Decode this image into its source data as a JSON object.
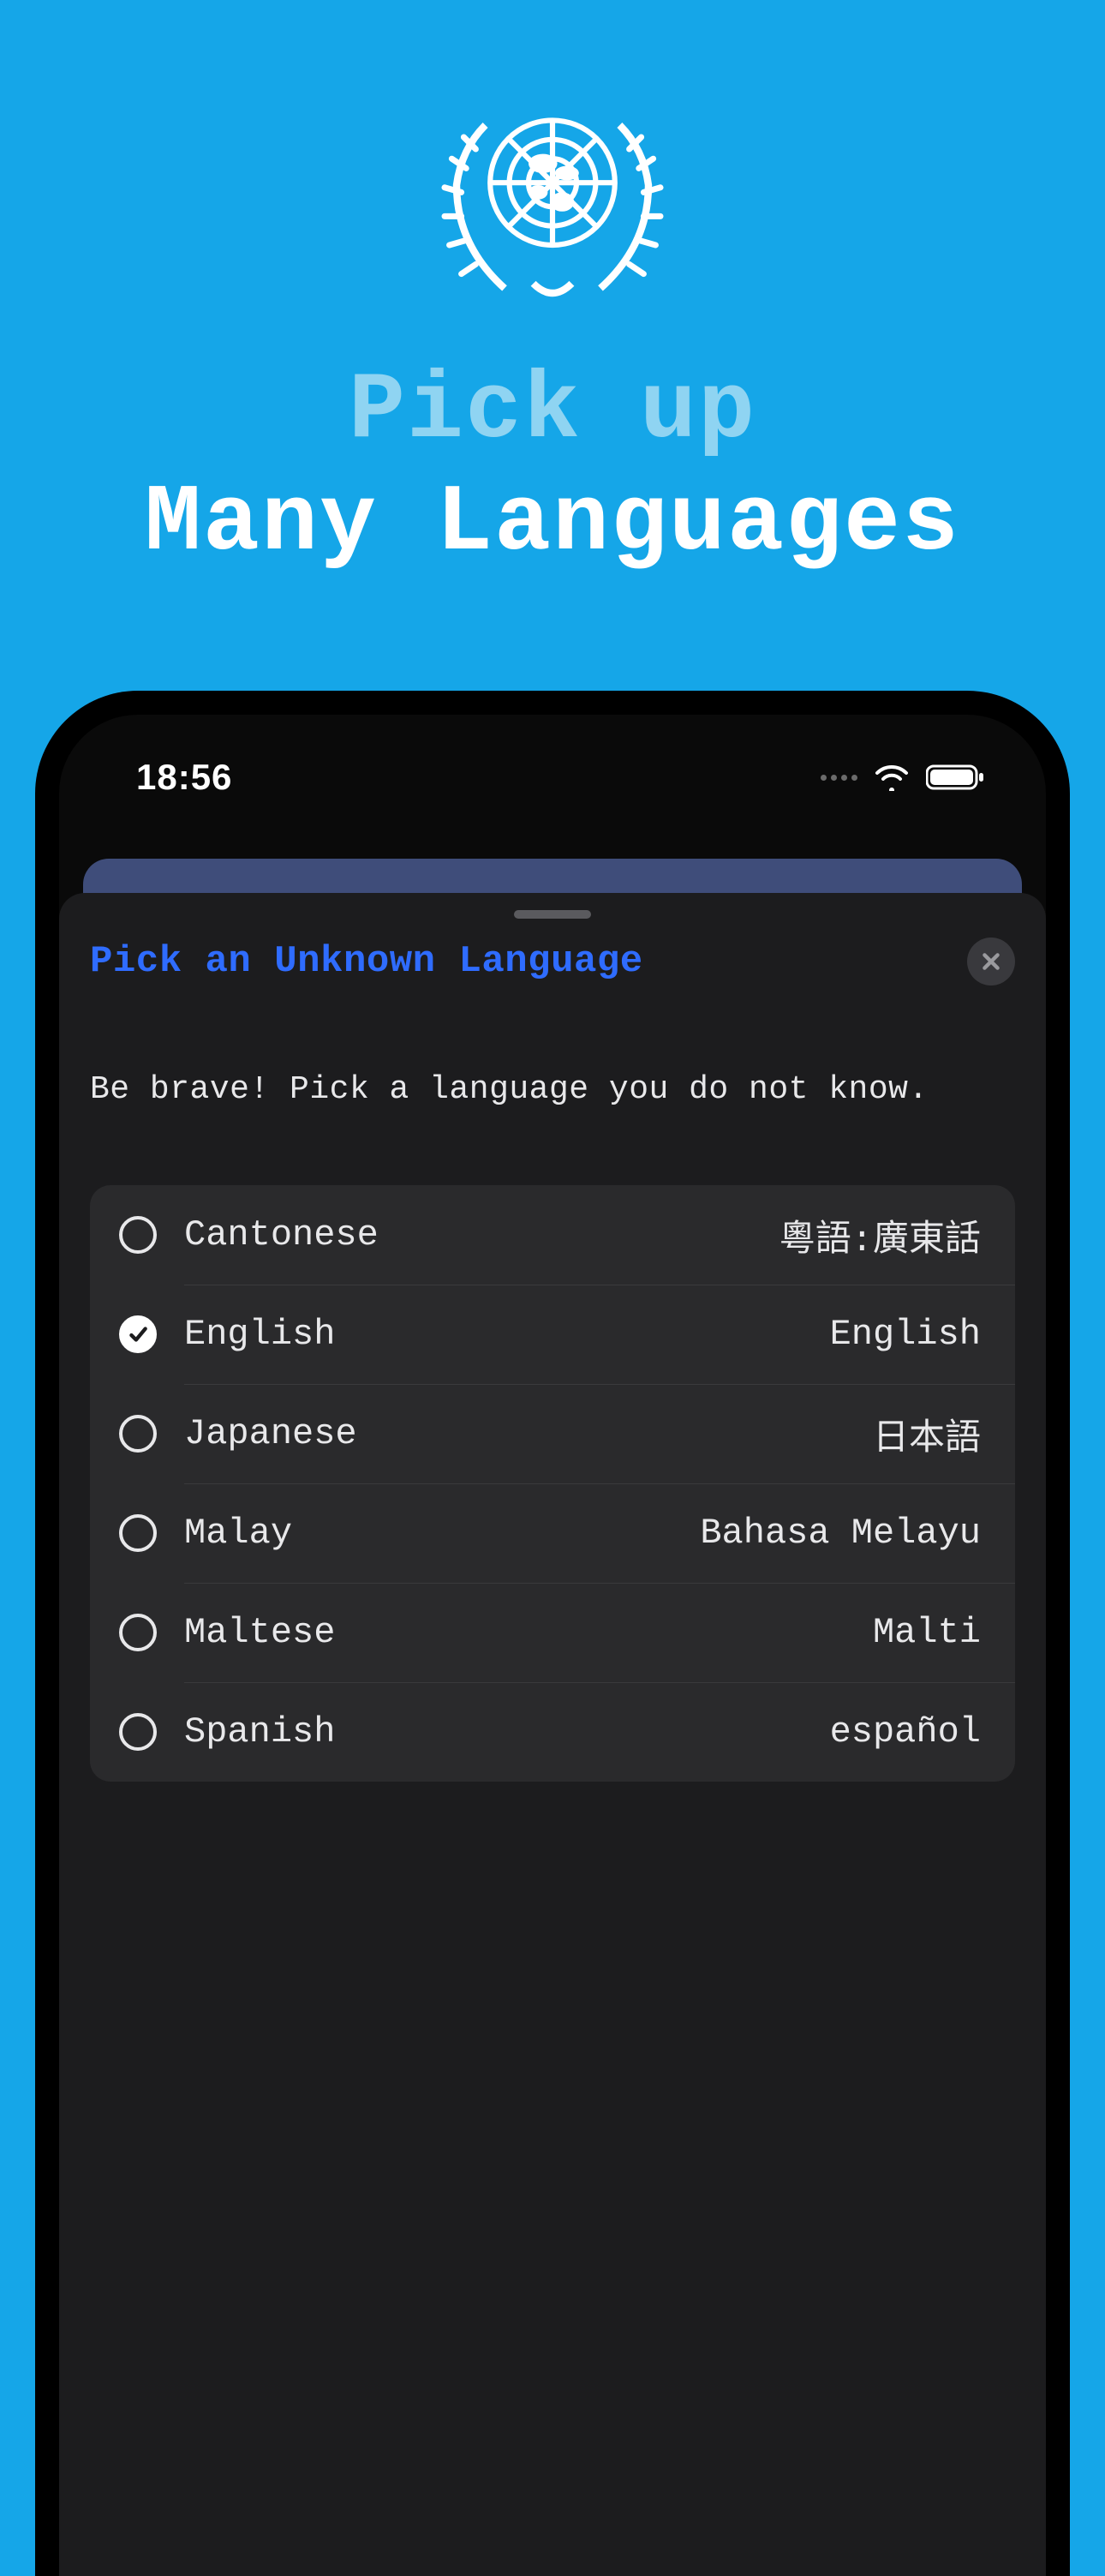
{
  "hero": {
    "line1": "Pick up",
    "line2": "Many Languages"
  },
  "status": {
    "time": "18:56"
  },
  "sheet": {
    "title": "Pick an Unknown Language",
    "subtitle": "Be brave! Pick a language you do not know.",
    "languages": [
      {
        "name": "Cantonese",
        "native": "粵語:廣東話",
        "selected": false
      },
      {
        "name": "English",
        "native": "English",
        "selected": true
      },
      {
        "name": "Japanese",
        "native": "日本語",
        "selected": false
      },
      {
        "name": "Malay",
        "native": "Bahasa Melayu",
        "selected": false
      },
      {
        "name": "Maltese",
        "native": "Malti",
        "selected": false
      },
      {
        "name": "Spanish",
        "native": "español",
        "selected": false
      }
    ]
  },
  "icons": {
    "emblem": "un-emblem-icon",
    "wifi": "wifi-icon",
    "battery": "battery-icon",
    "close": "close-icon",
    "check": "check-icon"
  }
}
